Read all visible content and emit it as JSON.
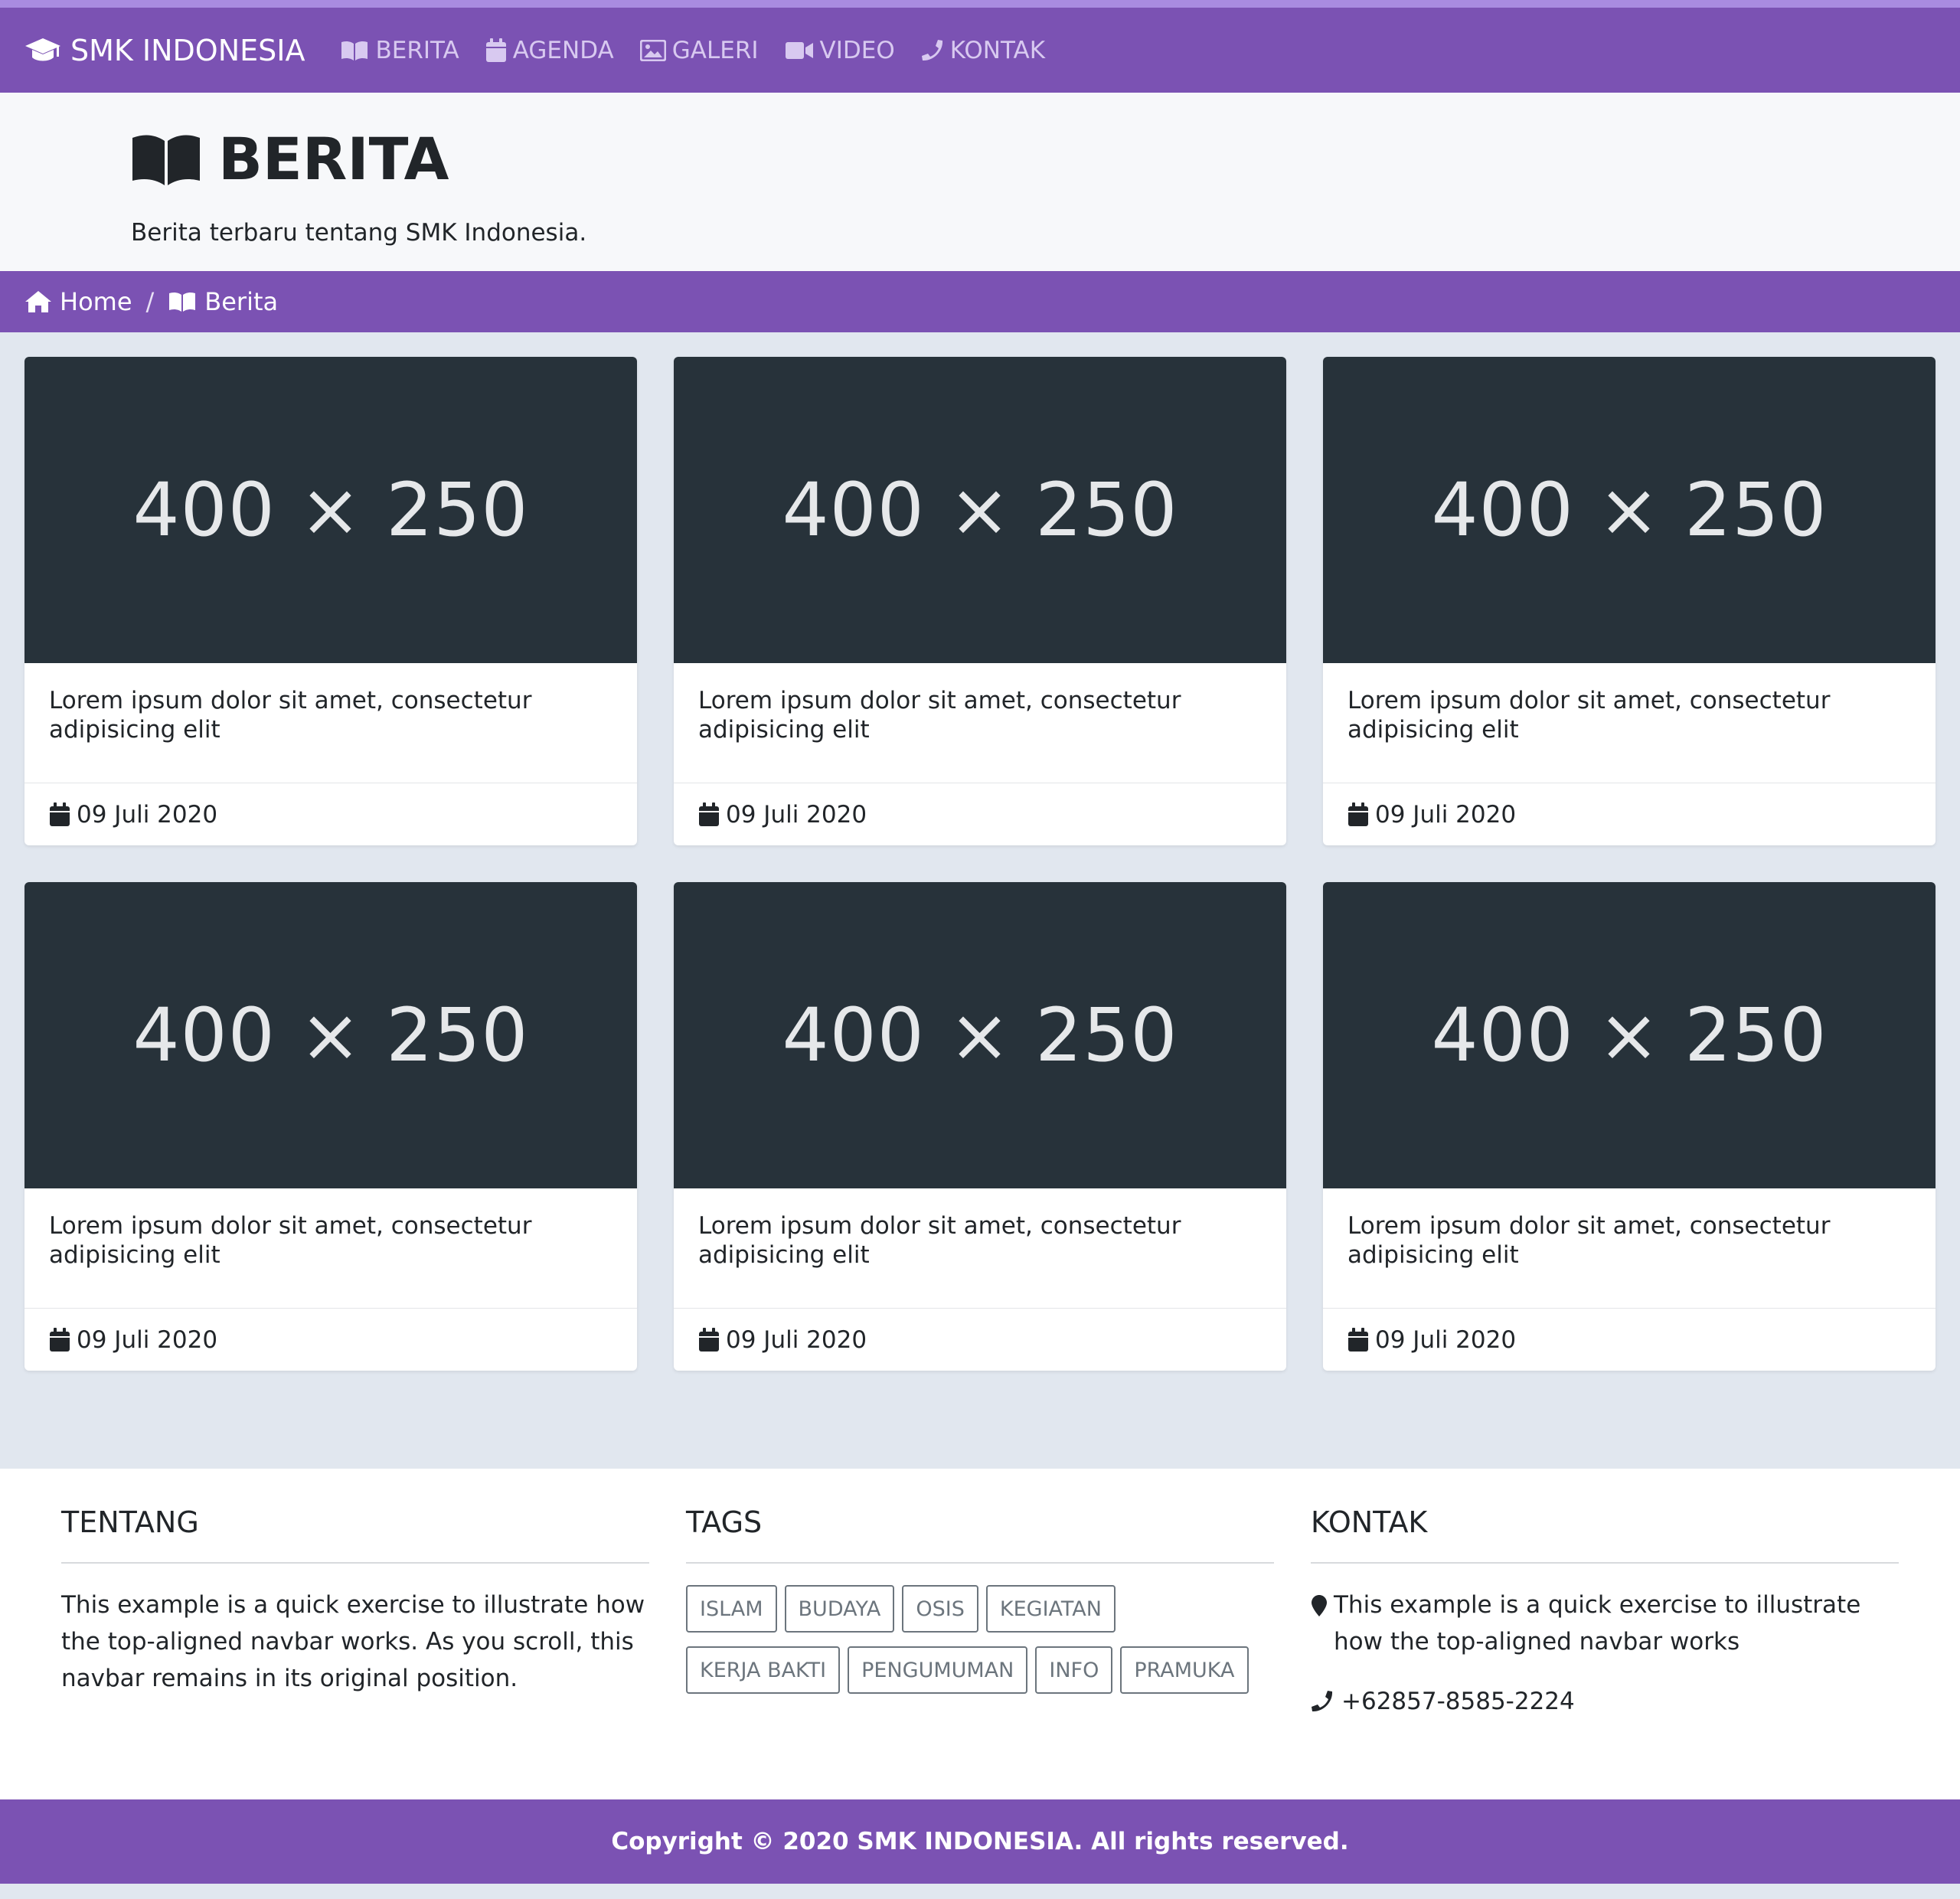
{
  "nav": {
    "brand": "SMK INDONESIA",
    "items": [
      {
        "label": "BERITA",
        "icon": "book-icon"
      },
      {
        "label": "AGENDA",
        "icon": "calendar-icon"
      },
      {
        "label": "GALERI",
        "icon": "image-icon"
      },
      {
        "label": "VIDEO",
        "icon": "video-icon"
      },
      {
        "label": "KONTAK",
        "icon": "phone-icon"
      }
    ]
  },
  "header": {
    "title": "BERITA",
    "subtitle": "Berita terbaru tentang SMK Indonesia."
  },
  "breadcrumb": {
    "home": "Home",
    "separator": "/",
    "current": "Berita"
  },
  "cards": [
    {
      "image_text": "400 × 250",
      "title": "Lorem ipsum dolor sit amet, consectetur adipisicing elit",
      "date": "09 Juli 2020"
    },
    {
      "image_text": "400 × 250",
      "title": "Lorem ipsum dolor sit amet, consectetur adipisicing elit",
      "date": "09 Juli 2020"
    },
    {
      "image_text": "400 × 250",
      "title": "Lorem ipsum dolor sit amet, consectetur adipisicing elit",
      "date": "09 Juli 2020"
    },
    {
      "image_text": "400 × 250",
      "title": "Lorem ipsum dolor sit amet, consectetur adipisicing elit",
      "date": "09 Juli 2020"
    },
    {
      "image_text": "400 × 250",
      "title": "Lorem ipsum dolor sit amet, consectetur adipisicing elit",
      "date": "09 Juli 2020"
    },
    {
      "image_text": "400 × 250",
      "title": "Lorem ipsum dolor sit amet, consectetur adipisicing elit",
      "date": "09 Juli 2020"
    }
  ],
  "footer": {
    "about": {
      "heading": "TENTANG",
      "text": "This example is a quick exercise to illustrate how the top-aligned navbar works. As you scroll, this navbar remains in its original position."
    },
    "tags": {
      "heading": "TAGS",
      "items": [
        "ISLAM",
        "BUDAYA",
        "OSIS",
        "KEGIATAN",
        "KERJA BAKTI",
        "PENGUMUMAN",
        "INFO",
        "PRAMUKA"
      ]
    },
    "contact": {
      "heading": "KONTAK",
      "address": "This example is a quick exercise to illustrate how the top-aligned navbar works",
      "phone": "+62857-8585-2224"
    }
  },
  "copyright": "Copyright © 2020 SMK INDONESIA. All rights reserved.",
  "colors": {
    "primary": "#7b52b3",
    "page_bg": "#e1e7ef",
    "placeholder_bg": "#27323a"
  }
}
